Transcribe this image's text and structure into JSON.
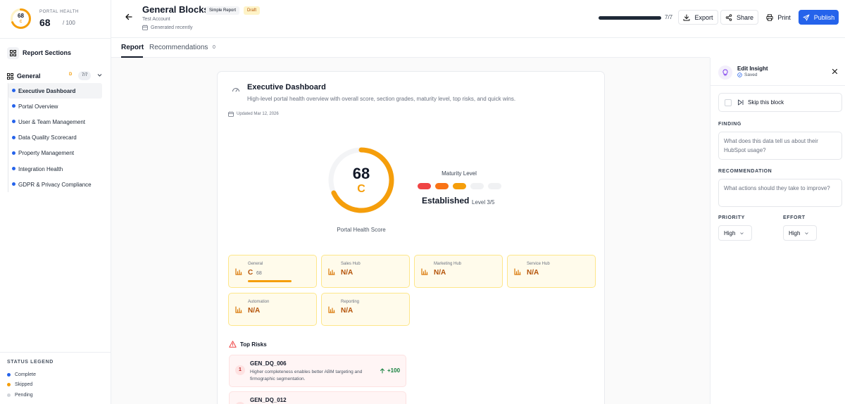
{
  "sidebar": {
    "portal_health": {
      "label": "PORTAL HEALTH",
      "score": "68",
      "max": "/ 100",
      "ring_value": "68",
      "ring_grade": "C",
      "fraction": 0.68
    },
    "report_sections_label": "Report Sections",
    "group": {
      "label": "General",
      "grade": "D",
      "count": "7/7"
    },
    "items": [
      {
        "label": "Executive Dashboard",
        "active": true
      },
      {
        "label": "Portal Overview"
      },
      {
        "label": "User & Team Management"
      },
      {
        "label": "Data Quality Scorecard"
      },
      {
        "label": "Property Management"
      },
      {
        "label": "Integration Health"
      },
      {
        "label": "GDPR & Privacy Compliance"
      }
    ],
    "legend": {
      "title": "STATUS LEGEND",
      "items": [
        {
          "label": "Complete",
          "color": "#2563eb"
        },
        {
          "label": "Skipped",
          "color": "#f59e0b"
        },
        {
          "label": "Pending",
          "color": "#d1d5db"
        }
      ]
    }
  },
  "header": {
    "title": "General Blocks",
    "simple_chip": "Simple Report",
    "draft_chip": "Draft",
    "account": "Test Account",
    "generated": "Generated recently",
    "progress_text": "7/7",
    "progress_fraction": 1.0,
    "buttons": {
      "export": "Export",
      "share": "Share",
      "print": "Print",
      "publish": "Publish"
    }
  },
  "tabs": {
    "report": "Report",
    "recommendations": "Recommendations",
    "rec_count": "0"
  },
  "block": {
    "title": "Executive Dashboard",
    "subtitle": "High-level portal health overview with overall score, section grades, maturity level, top risks, and quick wins.",
    "updated": "Updated Mar 12, 2026",
    "score": "68",
    "grade": "C",
    "score_fraction": 0.68,
    "score_caption": "Portal Health Score",
    "maturity": {
      "title": "Maturity Level",
      "name": "Established",
      "level": "Level 3/5",
      "filled": 3,
      "total": 5
    },
    "hubs": [
      {
        "name": "General",
        "grade": "C",
        "score": "68",
        "fraction": 0.68
      },
      {
        "name": "Sales Hub",
        "grade": "N/A"
      },
      {
        "name": "Marketing Hub",
        "grade": "N/A"
      },
      {
        "name": "Service Hub",
        "grade": "N/A"
      },
      {
        "name": "Automation",
        "grade": "N/A"
      },
      {
        "name": "Reporting",
        "grade": "N/A"
      }
    ],
    "top_risks_title": "Top Risks",
    "risks": [
      {
        "num": "1",
        "code": "GEN_DQ_006",
        "desc": "Higher completeness enables better ABM targeting and firmographic segmentation.",
        "points": "+100"
      },
      {
        "num": "2",
        "code": "GEN_DQ_012",
        "desc": "",
        "points": ""
      }
    ]
  },
  "panel": {
    "title": "Edit Insight",
    "saved": "Saved",
    "skip_label": "Skip this block",
    "finding_label": "FINDING",
    "finding_placeholder": "What does this data tell us about their HubSpot usage?",
    "rec_label": "RECOMMENDATION",
    "rec_placeholder": "What actions should they take to improve?",
    "priority_label": "PRIORITY",
    "priority_value": "High",
    "effort_label": "EFFORT",
    "effort_value": "High"
  },
  "colors": {
    "accent": "#2563eb",
    "amber": "#f59e0b",
    "risk_red": "#ef4444",
    "maturity": [
      "#ef4444",
      "#f97316",
      "#f59e0b",
      "#e5e7eb",
      "#e5e7eb"
    ]
  }
}
